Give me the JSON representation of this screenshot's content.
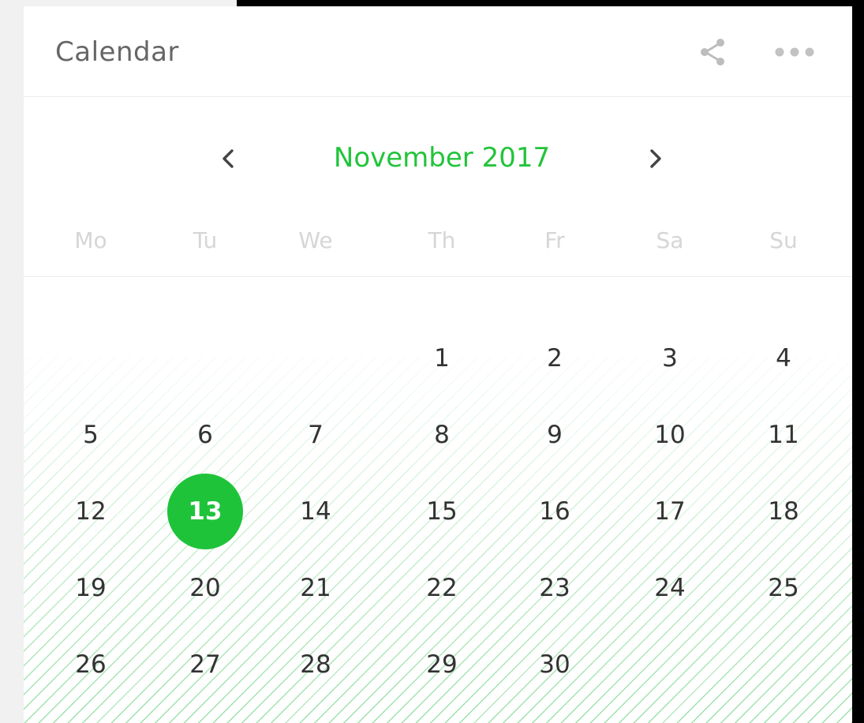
{
  "widget": {
    "title": "Calendar",
    "accent_color": "#22c43a",
    "icons": {
      "share": "share-icon",
      "more": "more-options-icon",
      "prev": "chevron-left-icon",
      "next": "chevron-right-icon"
    }
  },
  "calendar": {
    "month_label": "November 2017",
    "weekdays": [
      "Mo",
      "Tu",
      "We",
      "Th",
      "Fr",
      "Sa",
      "Su"
    ],
    "selected_day": "13",
    "weeks": [
      [
        "",
        "",
        "",
        "1",
        "2",
        "3",
        "4"
      ],
      [
        "5",
        "6",
        "7",
        "8",
        "9",
        "10",
        "11"
      ],
      [
        "12",
        "13",
        "14",
        "15",
        "16",
        "17",
        "18"
      ],
      [
        "19",
        "20",
        "21",
        "22",
        "23",
        "24",
        "25"
      ],
      [
        "26",
        "27",
        "28",
        "29",
        "30",
        "",
        ""
      ]
    ]
  }
}
